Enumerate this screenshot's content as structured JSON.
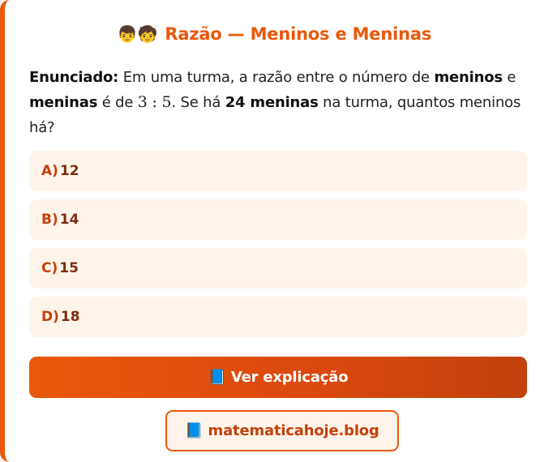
{
  "title": {
    "emoji": "👦🧒",
    "text": "Razão — Meninos e Meninas"
  },
  "statement": {
    "label": "Enunciado:",
    "part1": " Em uma turma, a razão entre o número de ",
    "bold1": "meninos",
    "part2": " e ",
    "bold2": "meninas",
    "part3": " é de ",
    "ratio": "3 : 5",
    "part4": ". Se há ",
    "bold3": "24 meninas",
    "part5": " na turma, quantos meninos há?"
  },
  "options": [
    {
      "letter": "A)",
      "value": "12"
    },
    {
      "letter": "B)",
      "value": "14"
    },
    {
      "letter": "C)",
      "value": "15"
    },
    {
      "letter": "D)",
      "value": "18"
    }
  ],
  "explain_button": {
    "icon": "📘",
    "label": "Ver explicação"
  },
  "blog_link": {
    "icon": "📘",
    "label": "matematicahoje.blog"
  },
  "colors": {
    "accent": "#ea580c",
    "option_bg": "#fff4ea",
    "option_text": "#7c2d12"
  }
}
